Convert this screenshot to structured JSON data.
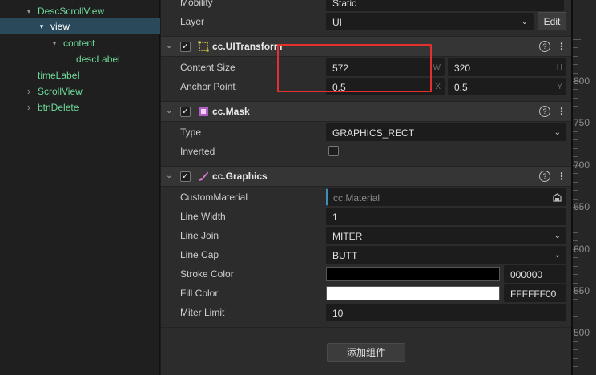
{
  "hierarchy": [
    {
      "label": "DescScrollView",
      "arrow": "▾",
      "selected": false
    },
    {
      "label": "view",
      "arrow": "▾",
      "selected": true
    },
    {
      "label": "content",
      "arrow": "▾",
      "selected": false
    },
    {
      "label": "descLabel",
      "arrow": "",
      "selected": false
    },
    {
      "label": "timeLabel",
      "arrow": "",
      "selected": false
    },
    {
      "label": "ScrollView",
      "arrow": "›",
      "selected": false
    },
    {
      "label": "btnDelete",
      "arrow": "›",
      "selected": false
    }
  ],
  "node": {
    "mobility_label": "Mobility",
    "mobility_value": "Static",
    "layer_label": "Layer",
    "layer_value": "UI",
    "edit_label": "Edit"
  },
  "ui_transform": {
    "title": "cc.UITransform",
    "content_size_label": "Content Size",
    "width": "572",
    "width_axis": "W",
    "height": "320",
    "height_axis": "H",
    "anchor_label": "Anchor Point",
    "anchor_x": "0.5",
    "anchor_x_axis": "X",
    "anchor_y": "0.5",
    "anchor_y_axis": "Y"
  },
  "mask": {
    "title": "cc.Mask",
    "type_label": "Type",
    "type_value": "GRAPHICS_RECT",
    "inverted_label": "Inverted",
    "inverted": false
  },
  "graphics": {
    "title": "cc.Graphics",
    "custom_material_label": "CustomMaterial",
    "custom_material_placeholder": "cc.Material",
    "line_width_label": "Line Width",
    "line_width": "1",
    "line_join_label": "Line Join",
    "line_join": "MITER",
    "line_cap_label": "Line Cap",
    "line_cap": "BUTT",
    "stroke_color_label": "Stroke Color",
    "stroke_color": "000000",
    "fill_color_label": "Fill Color",
    "fill_color": "FFFFFF00",
    "miter_limit_label": "Miter Limit",
    "miter_limit": "10"
  },
  "add_component_label": "添加组件",
  "help_glyph": "?",
  "menu_glyph": "⋮",
  "check_glyph": "✓",
  "chevron_glyph": "⌄",
  "ruler_labels": [
    "800",
    "750",
    "700",
    "650",
    "600",
    "550",
    "500"
  ],
  "colors": {
    "selection": "#2a4a5c",
    "node_text": "#6fd99a",
    "highlight": "#e53030",
    "stroke_swatch": "#000000",
    "fill_swatch": "#ffffff",
    "transform_icon": "#e8d44d",
    "mask_icon": "#b45cc8",
    "graphics_icon": "#e07ad8"
  }
}
